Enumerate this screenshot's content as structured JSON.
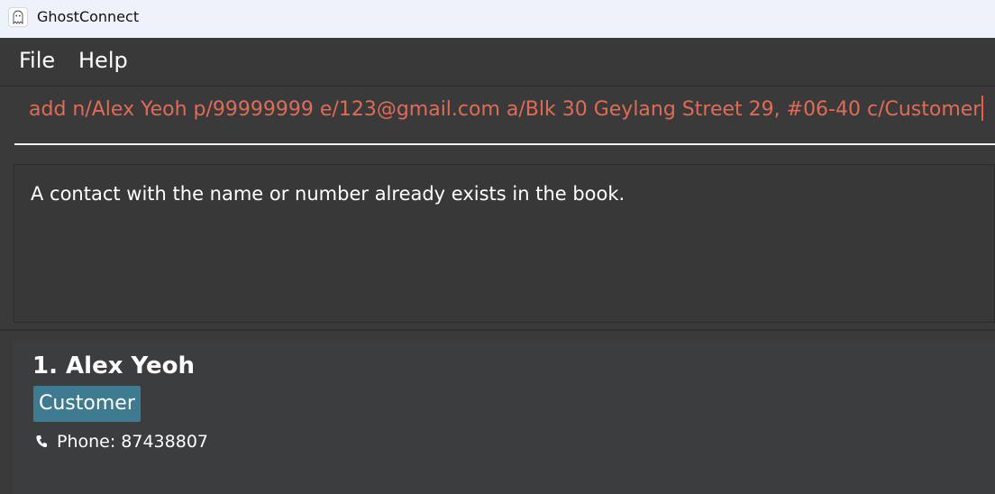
{
  "window": {
    "title": "GhostConnect",
    "icon": "ghost-icon"
  },
  "menu": {
    "items": [
      "File",
      "Help"
    ]
  },
  "command": {
    "value": "add n/Alex Yeoh p/99999999 e/123@gmail.com a/Blk 30 Geylang Street 29, #06-40 c/Customer",
    "error_color": "#e06b56"
  },
  "result": {
    "message": "A contact with the name or number already exists in the book."
  },
  "contacts": [
    {
      "index": "1.",
      "name": "Alex Yeoh",
      "tag": "Customer",
      "phone_label": "Phone: 87438807",
      "phone_icon": "phone-icon"
    }
  ],
  "colors": {
    "tag_bg": "#3e7b91",
    "background": "#3a3a3a",
    "titlebar_bg": "#eef3fb"
  }
}
